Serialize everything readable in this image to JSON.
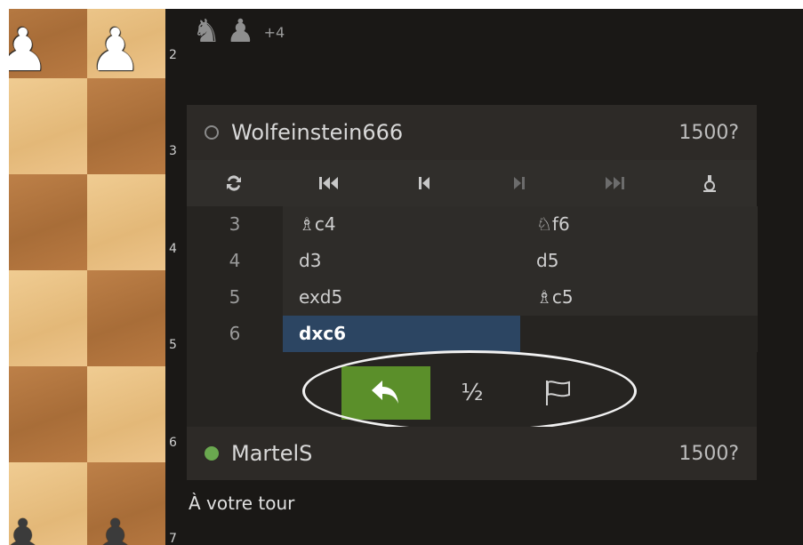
{
  "board": {
    "pieces": [
      {
        "glyph": "♟",
        "name": "white-pawn-icon"
      },
      {
        "glyph": "♟",
        "name": "white-pawn-icon"
      },
      {
        "glyph": "♟",
        "name": "black-pawn-icon"
      },
      {
        "glyph": "♟",
        "name": "black-pawn-icon"
      }
    ]
  },
  "ranks": [
    "2",
    "3",
    "4",
    "5",
    "6",
    "7"
  ],
  "material": {
    "pieces": [
      "♞",
      "♟"
    ],
    "advantage": "+4"
  },
  "opponent": {
    "name": "Wolfeinstein666",
    "rating": "1500?",
    "status": "offline"
  },
  "player": {
    "name": "MartelS",
    "rating": "1500?",
    "status": "online"
  },
  "controls": [
    {
      "name": "flip-board-icon",
      "glyph": "⇅"
    },
    {
      "name": "first-move-icon",
      "glyph": "⏮"
    },
    {
      "name": "previous-move-icon",
      "glyph": "⏴"
    },
    {
      "name": "next-move-icon",
      "glyph": "⏵"
    },
    {
      "name": "last-move-icon",
      "glyph": "⏭"
    },
    {
      "name": "analysis-icon",
      "glyph": "⚗"
    }
  ],
  "moves": [
    {
      "num": "3",
      "white": "♗c4",
      "black": "♘f6"
    },
    {
      "num": "4",
      "white": "d3",
      "black": "d5"
    },
    {
      "num": "5",
      "white": "exd5",
      "black": "♗c5"
    },
    {
      "num": "6",
      "white": "dxc6",
      "black": ""
    }
  ],
  "actions": {
    "draw_label": "½"
  },
  "status_text": "À votre tour",
  "colors": {
    "accent_green": "#5b8f2a",
    "active_move": "#2c4562",
    "online": "#6aa84f"
  }
}
